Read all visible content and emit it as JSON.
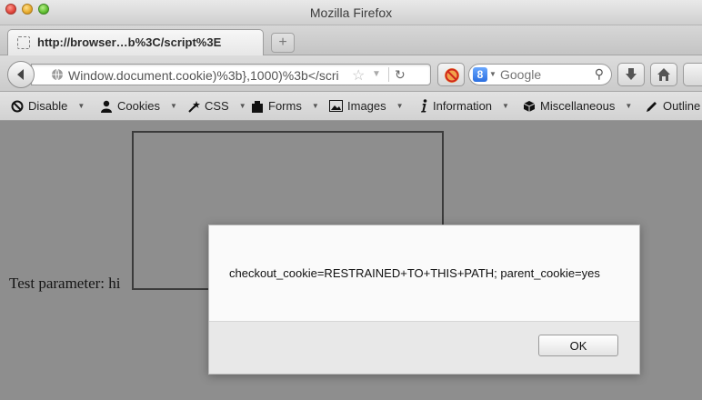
{
  "window": {
    "title": "Mozilla Firefox"
  },
  "tab": {
    "title": "http://browser…b%3C/script%3E",
    "new_tab_symbol": "+"
  },
  "nav": {
    "url": "Window.document.cookie)%3b},1000)%3b</scri",
    "search_placeholder": "Google",
    "search_engine_letter": "8"
  },
  "devbar": {
    "items": [
      {
        "label": "Disable",
        "icon": "disable-icon"
      },
      {
        "label": "Cookies",
        "icon": "cookies-icon"
      },
      {
        "label": "CSS",
        "icon": "css-icon"
      },
      {
        "label": "Forms",
        "icon": "forms-icon"
      },
      {
        "label": "Images",
        "icon": "images-icon"
      },
      {
        "label": "Information",
        "icon": "information-icon"
      },
      {
        "label": "Miscellaneous",
        "icon": "miscellaneous-icon"
      },
      {
        "label": "Outline",
        "icon": "outline-icon"
      }
    ]
  },
  "page": {
    "text": "Test parameter: hi"
  },
  "dialog": {
    "message": "checkout_cookie=RESTRAINED+TO+THIS+PATH; parent_cookie=yes",
    "ok_label": "OK"
  }
}
